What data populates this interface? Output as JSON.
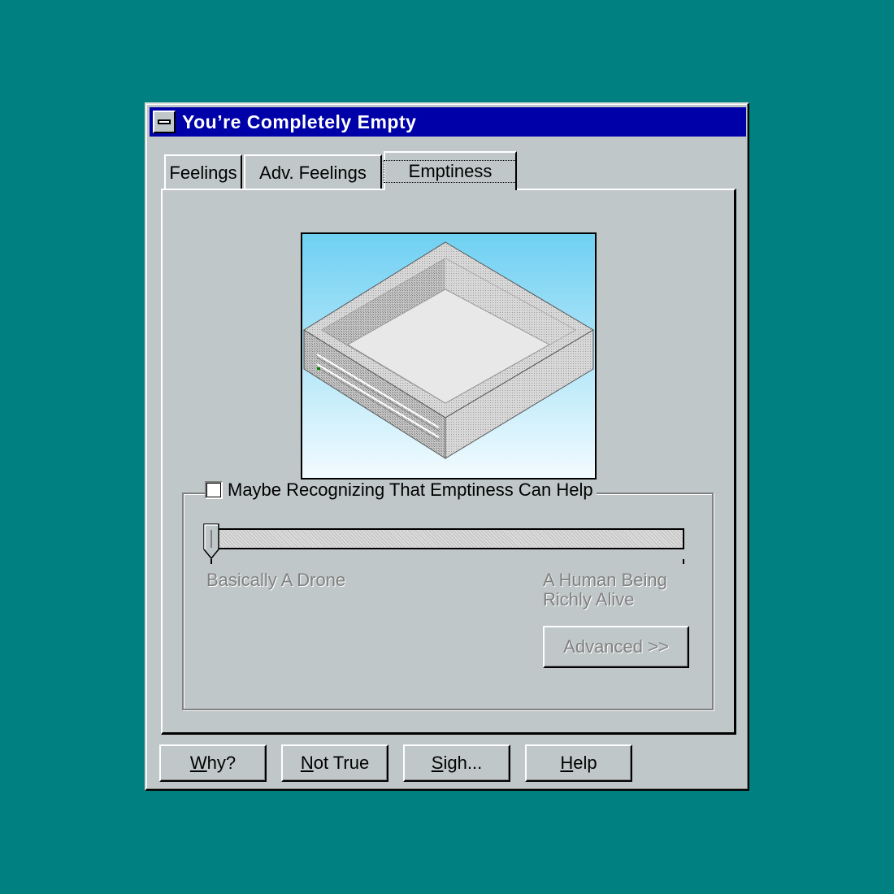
{
  "window": {
    "title": "You’re Completely Empty"
  },
  "tabs": [
    {
      "label": "Feelings",
      "active": false
    },
    {
      "label": "Adv. Feelings",
      "active": false
    },
    {
      "label": "Emptiness",
      "active": true
    }
  ],
  "picture": {
    "icon": "empty-box-illustration"
  },
  "group": {
    "checkbox_label": "Maybe Recognizing That Emptiness Can Help",
    "checkbox_checked": false
  },
  "slider": {
    "value_fraction": 0.0,
    "min_label": "Basically A Drone",
    "max_label_line1": "A Human Being",
    "max_label_line2": "Richly Alive"
  },
  "advanced_button": {
    "label": "Advanced >>",
    "enabled": false
  },
  "footer_buttons": [
    {
      "mnemonic": "W",
      "rest": "hy?"
    },
    {
      "mnemonic": "N",
      "rest": "ot True"
    },
    {
      "mnemonic": "S",
      "rest": "igh..."
    },
    {
      "mnemonic": "H",
      "rest": "elp"
    }
  ],
  "colors": {
    "desktop": "#008080",
    "titlebar": "#0000a8",
    "face": "#c0c7c8"
  }
}
